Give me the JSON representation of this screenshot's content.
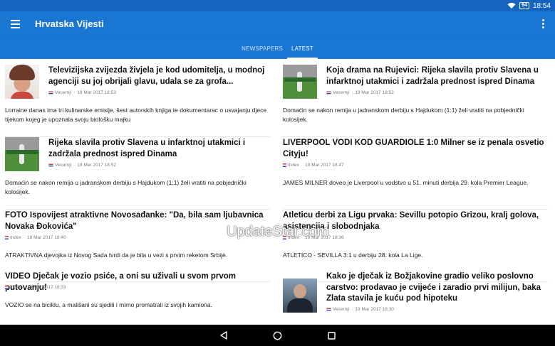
{
  "status_bar": {
    "battery": "94",
    "time": "18:54"
  },
  "app_bar": {
    "title": "Hrvatska Vijesti",
    "menu_icon": "hamburger-menu-icon",
    "overflow_icon": "overflow-menu-icon"
  },
  "tabs": [
    {
      "label": "NEWSPAPERS",
      "active": false
    },
    {
      "label": "LATEST",
      "active": true
    }
  ],
  "articles": [
    {
      "headline": "Televizijska zvijezda živjela je kod udomitelja, u modnoj agenciji su joj obrijali glavu, udala se za grofa...",
      "source": "Vecernji",
      "date": "19 Mar 2017 18:53",
      "summary": "Lorraine danas ima tri kulinarske emisije, šest autorskih knjiga te dokumentarac o usvajanju djece tijekom kojeg je upoznala svoju biološku majku",
      "thumb": "portrait"
    },
    {
      "headline": "Koja drama na Rujevici: Rijeka slavila protiv Slavena u infarktnoj utakmici i zadržala prednost ispred Dinama",
      "source": "Vecernji",
      "date": "19 Mar 2017 18:52",
      "summary": "Domaćin se nakon remija u jadranskom derbiju s Hajdukom (1:1) želi vratiti na pobjednički kolosijek.",
      "thumb": "football"
    },
    {
      "headline": "Rijeka slavila protiv Slavena u infarktnoj utakmici i zadržala prednost ispred Dinama",
      "source": "Vecernji",
      "date": "19 Mar 2017 18:52",
      "summary": "Domaćin se nakon remija u jadranskom derbiju s Hajdukom (1:1) želi vratiti na pobjednički kolosijek.",
      "thumb": "football"
    },
    {
      "headline": "LIVERPOOL VODI KOD GUARDIOLE 1:0 Milner se iz penala osvetio Cityju!",
      "source": "Index",
      "date": "19 Mar 2017 18:47",
      "summary": "JAMES MILNER doveo je Liverpool u vodstvo u 51. minuti derbija 29. kola Premier League.",
      "thumb": ""
    },
    {
      "headline": "FOTO Ispovijest atraktivne Novosađanke: \"Da, bila sam ljubavnica Novaka Đokovića\"",
      "source": "Index",
      "date": "19 Mar 2017 18:40",
      "summary": "ATRAKTIVNA djevojka iz Novog Sada tvrdi da je bila u vezi s prvim reketom Srbije.",
      "thumb": ""
    },
    {
      "headline": "Atleticu derbi za Ligu prvaka: Sevillu potopio Grizou, kralj golova, asistencija i slobodnjaka",
      "source": "Index",
      "date": "19 Mar 2017 18:36",
      "summary": "ATLETICO - SEVILLA 3:1 u derbiju 28. kola La Lige.",
      "thumb": ""
    },
    {
      "headline": "VIDEO Dječak je vozio psiće, a oni su uživali u svom prvom putovanju!",
      "source": "Index",
      "date": "19 Mar 2017 18:33",
      "summary": "VOZIO se na biciklu, a mališani su sjedili i mirno promatrali iz svojih kamiona.",
      "thumb": ""
    },
    {
      "headline": "Kako je dječak iz Božjakovine gradio veliko poslovno carstvo: prodavao je cvijeće i zaradio prvi milijun, baka Zlata stavila je kuću pod hipoteku",
      "source": "Vecernji",
      "date": "19 Mar 2017 18:30",
      "summary": "",
      "thumb": "person"
    }
  ],
  "watermark": "UpdateStar.com",
  "nav_bar": {
    "back_icon": "back-triangle-icon",
    "home_icon": "home-circle-icon",
    "recents_icon": "recents-square-icon"
  }
}
